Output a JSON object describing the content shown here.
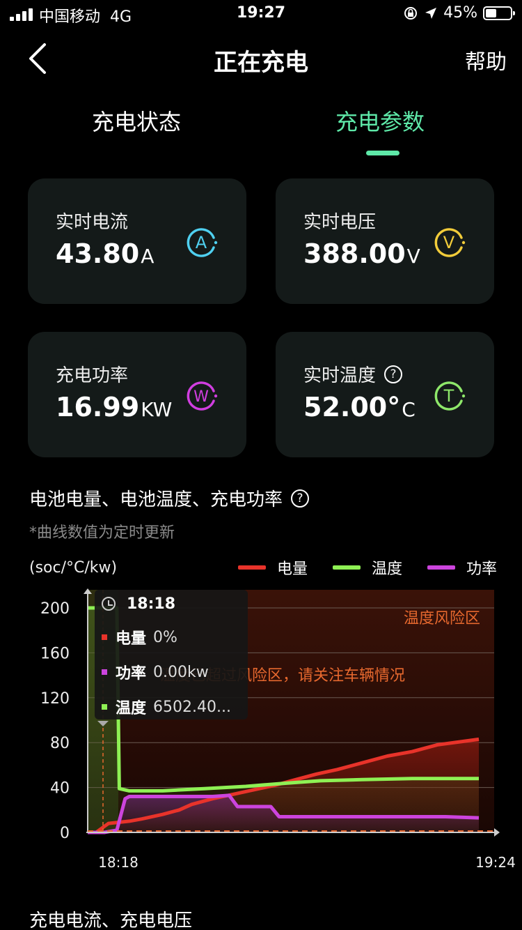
{
  "status_bar": {
    "carrier": "中国移动",
    "network": "4G",
    "time": "19:27",
    "battery": "45%"
  },
  "nav": {
    "title": "正在充电",
    "help": "帮助"
  },
  "tabs": [
    {
      "label": "充电状态",
      "active": false
    },
    {
      "label": "充电参数",
      "active": true
    }
  ],
  "colors": {
    "accent": "#5ee8a8",
    "current": "#4fd0f0",
    "voltage": "#f2cc3a",
    "power": "#d13ee0",
    "temp": "#8ee86a",
    "soc_line": "#e8332a",
    "temp_line": "#8ef054",
    "power_line": "#cc44dd",
    "risk_text": "#e6682e"
  },
  "cards": {
    "current": {
      "label": "实时电流",
      "value": "43.80",
      "unit": "A",
      "icon": "A"
    },
    "voltage": {
      "label": "实时电压",
      "value": "388.00",
      "unit": "V",
      "icon": "V"
    },
    "power": {
      "label": "充电功率",
      "value": "16.99",
      "unit": "KW",
      "icon": "W"
    },
    "temp": {
      "label": "实时温度",
      "value": "52.00°",
      "unit": "C",
      "icon": "T",
      "help_icon": "?"
    }
  },
  "chart_section": {
    "title": "电池电量、电池温度、充电功率",
    "help_icon": "?",
    "note": "*曲线数值为定时更新",
    "ylabel": "(soc/°C/kw)",
    "risk_zone_label": "温度风险区",
    "risk_warning": "温度已超过风险区，请关注车辆情况",
    "tooltip": {
      "time": "18:18",
      "soc_label": "电量",
      "soc_value": "0%",
      "power_label": "功率",
      "power_value": "0.00kw",
      "temp_label": "温度",
      "temp_value": "6502.40..."
    }
  },
  "chart_data": {
    "type": "line",
    "ylim": [
      0,
      200
    ],
    "yticks": [
      "200",
      "160",
      "120",
      "80",
      "40",
      "0"
    ],
    "xticks": [
      "18:18",
      "19:24"
    ],
    "legend": [
      "电量",
      "温度",
      "功率"
    ],
    "legend_position": "top-right",
    "grid": true,
    "series": [
      {
        "name": "电量",
        "color": "#e8332a",
        "points": [
          [
            0,
            0
          ],
          [
            2,
            0
          ],
          [
            5,
            8
          ],
          [
            10,
            10
          ],
          [
            13,
            12
          ],
          [
            18,
            16
          ],
          [
            22,
            20
          ],
          [
            25,
            25
          ],
          [
            30,
            30
          ],
          [
            35,
            34
          ],
          [
            40,
            38
          ],
          [
            45,
            42
          ],
          [
            50,
            47
          ],
          [
            55,
            52
          ],
          [
            60,
            56
          ],
          [
            66,
            62
          ],
          [
            72,
            68
          ],
          [
            78,
            72
          ],
          [
            84,
            78
          ],
          [
            90,
            81
          ],
          [
            94,
            83
          ]
        ]
      },
      {
        "name": "温度",
        "color": "#8ef054",
        "points": [
          [
            0,
            200
          ],
          [
            7,
            200
          ],
          [
            7.6,
            39
          ],
          [
            10,
            37
          ],
          [
            18,
            37
          ],
          [
            28,
            39
          ],
          [
            38,
            41
          ],
          [
            48,
            44
          ],
          [
            56,
            46
          ],
          [
            66,
            47
          ],
          [
            78,
            48
          ],
          [
            94,
            48
          ]
        ]
      },
      {
        "name": "功率",
        "color": "#cc44dd",
        "points": [
          [
            0,
            0
          ],
          [
            4,
            0
          ],
          [
            7,
            2
          ],
          [
            9,
            30
          ],
          [
            10,
            32
          ],
          [
            30,
            32
          ],
          [
            34,
            33
          ],
          [
            36,
            23
          ],
          [
            44,
            23
          ],
          [
            46,
            14
          ],
          [
            60,
            14
          ],
          [
            75,
            14
          ],
          [
            86,
            14
          ],
          [
            94,
            13
          ]
        ]
      }
    ]
  },
  "section2_title": "充电电流、充电电压"
}
